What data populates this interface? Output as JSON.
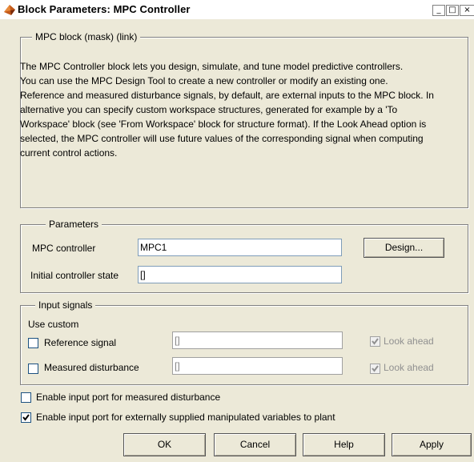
{
  "window": {
    "title": "Block Parameters: MPC Controller",
    "icon": "matlab-icon",
    "controls": {
      "minimize": "_",
      "maximize": "□",
      "close": "×"
    }
  },
  "mask_group": {
    "legend": "MPC block (mask) (link)",
    "paragraphs": [
      "The MPC Controller block lets you design, simulate, and tune model predictive controllers.",
      "You can use the MPC Design Tool to create a new controller or modify an existing one.",
      "Reference and measured disturbance signals, by default, are external inputs to the MPC block. In alternative you can specify custom workspace structures, generated for example by a 'To Workspace' block (see 'From Workspace' block for structure format). If the Look Ahead option is selected, the MPC controller will use future values of the corresponding signal when computing current control actions."
    ]
  },
  "parameters": {
    "legend": "Parameters",
    "mpc_controller_label": "MPC controller",
    "mpc_controller_value": "MPC1",
    "initial_state_label": "Initial controller state",
    "initial_state_value": "[]",
    "design_button": "Design..."
  },
  "input_signals": {
    "legend": "Input signals",
    "use_custom_label": "Use custom",
    "reference_label": "Reference signal",
    "reference_value": "[]",
    "reference_checked": false,
    "reference_lookahead_label": "Look ahead",
    "reference_lookahead_checked": true,
    "measured_label": "Measured disturbance",
    "measured_value": "[]",
    "measured_checked": false,
    "measured_lookahead_label": "Look ahead",
    "measured_lookahead_checked": true
  },
  "options": {
    "enable_md_port_label": "Enable input port for measured disturbance",
    "enable_md_port_checked": false,
    "enable_mv_port_label": "Enable input port for externally supplied manipulated variables to plant",
    "enable_mv_port_checked": true
  },
  "buttons": {
    "ok": "OK",
    "cancel": "Cancel",
    "help": "Help",
    "apply": "Apply"
  }
}
